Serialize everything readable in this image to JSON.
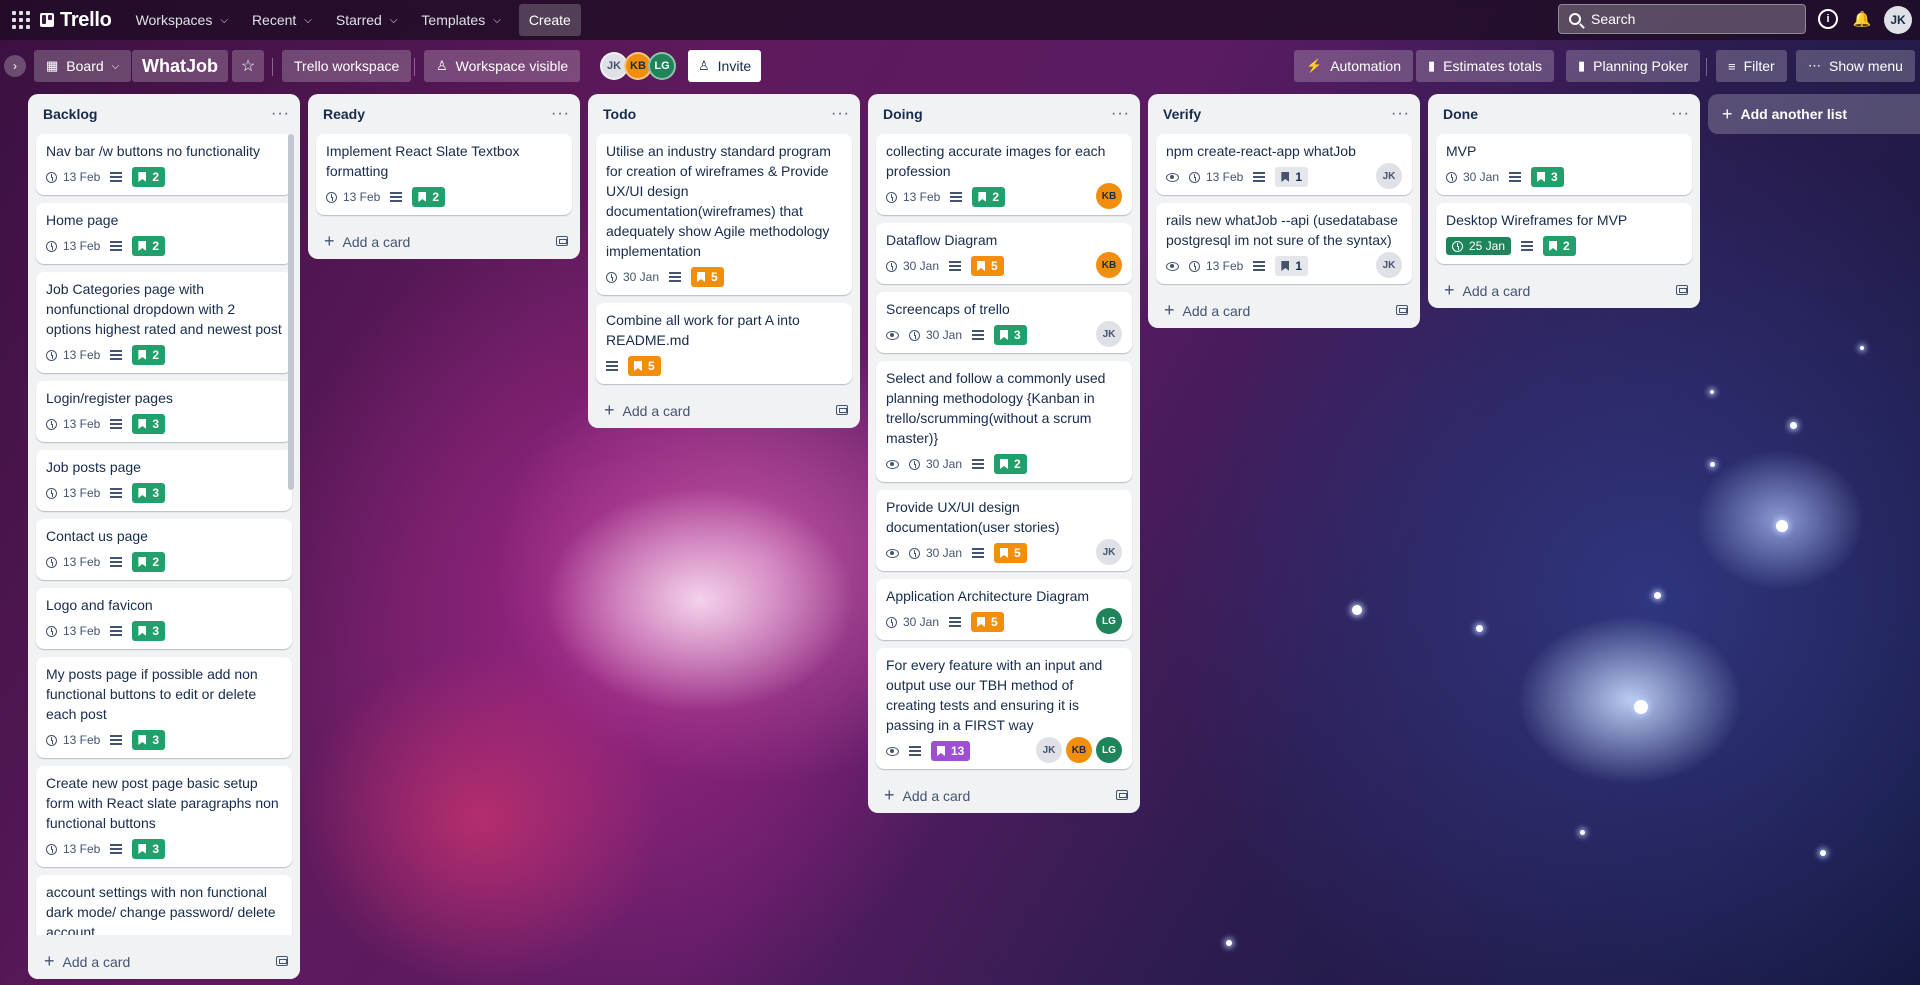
{
  "topnav": {
    "logo_text": "Trello",
    "menu": [
      {
        "label": "Workspaces",
        "has_chevron": true
      },
      {
        "label": "Recent",
        "has_chevron": true
      },
      {
        "label": "Starred",
        "has_chevron": true
      },
      {
        "label": "Templates",
        "has_chevron": true
      }
    ],
    "create_label": "Create",
    "search_placeholder": "Search",
    "user_initials": "JK"
  },
  "board": {
    "view_label": "Board",
    "title": "WhatJob",
    "workspace_label": "Trello workspace",
    "visibility_label": "Workspace visible",
    "invite_label": "Invite",
    "members": [
      "JK",
      "KB",
      "LG"
    ],
    "powerups": [
      "Automation",
      "Estimates totals",
      "Planning Poker"
    ],
    "filter_label": "Filter",
    "show_menu_label": "Show menu"
  },
  "lists": [
    {
      "title": "Backlog",
      "add_card_label": "Add a card",
      "cards": [
        {
          "title": "Nav bar /w buttons no functionality",
          "date": "13 Feb",
          "desc": true,
          "points": "2",
          "color": "green"
        },
        {
          "title": "Home page",
          "date": "13 Feb",
          "desc": true,
          "points": "2",
          "color": "green"
        },
        {
          "title": "Job Categories page with nonfunctional dropdown with 2 options highest rated and newest post",
          "date": "13 Feb",
          "desc": true,
          "points": "2",
          "color": "green"
        },
        {
          "title": "Login/register pages",
          "date": "13 Feb",
          "desc": true,
          "points": "3",
          "color": "green"
        },
        {
          "title": "Job posts page",
          "date": "13 Feb",
          "desc": true,
          "points": "3",
          "color": "green"
        },
        {
          "title": "Contact us page",
          "date": "13 Feb",
          "desc": true,
          "points": "2",
          "color": "green"
        },
        {
          "title": "Logo and favicon",
          "date": "13 Feb",
          "desc": true,
          "points": "3",
          "color": "green"
        },
        {
          "title": "My posts page if possible add non functional buttons to edit or delete each post",
          "date": "13 Feb",
          "desc": true,
          "points": "3",
          "color": "green"
        },
        {
          "title": "Create new post page basic setup form with React slate paragraphs non functional buttons",
          "date": "13 Feb",
          "desc": true,
          "points": "3",
          "color": "green"
        },
        {
          "title": "account settings with non functional dark mode/ change password/ delete account"
        }
      ]
    },
    {
      "title": "Ready",
      "add_card_label": "Add a card",
      "cards": [
        {
          "title": "Implement React Slate Textbox formatting",
          "date": "13 Feb",
          "desc": true,
          "points": "2",
          "color": "green"
        }
      ]
    },
    {
      "title": "Todo",
      "add_card_label": "Add a card",
      "cards": [
        {
          "title": "Utilise an industry standard program for creation of wireframes & Provide UX/UI design documentation(wireframes) that adequately show Agile methodology implementation",
          "date": "30 Jan",
          "desc": true,
          "points": "5",
          "color": "orange"
        },
        {
          "title": "Combine all work for part A into README.md",
          "desc": true,
          "points": "5",
          "color": "orange"
        }
      ]
    },
    {
      "title": "Doing",
      "add_card_label": "Add a card",
      "cards": [
        {
          "title": "collecting accurate images for each profession",
          "date": "13 Feb",
          "desc": true,
          "points": "2",
          "color": "green",
          "members": [
            "KB"
          ]
        },
        {
          "title": "Dataflow Diagram",
          "date": "30 Jan",
          "desc": true,
          "points": "5",
          "color": "orange",
          "members": [
            "KB"
          ]
        },
        {
          "title": "Screencaps of trello",
          "watch": true,
          "date": "30 Jan",
          "desc": true,
          "points": "3",
          "color": "green",
          "members": [
            "JK"
          ]
        },
        {
          "title": "Select and follow a commonly used planning methodology {Kanban in trello/scrumming(without a scrum master)}",
          "watch": true,
          "date": "30 Jan",
          "desc": true,
          "points": "2",
          "color": "green"
        },
        {
          "title": "Provide UX/UI design documentation(user stories)",
          "watch": true,
          "date": "30 Jan",
          "desc": true,
          "points": "5",
          "color": "orange",
          "members": [
            "JK"
          ]
        },
        {
          "title": "Application Architecture Diagram",
          "date": "30 Jan",
          "desc": true,
          "points": "5",
          "color": "orange",
          "members": [
            "LG"
          ]
        },
        {
          "title": "For every feature with an input and output use our TBH method of creating tests and ensuring it is passing in a FIRST way",
          "watch": true,
          "desc": true,
          "points": "13",
          "color": "purple",
          "members": [
            "JK",
            "KB",
            "LG"
          ]
        }
      ]
    },
    {
      "title": "Verify",
      "add_card_label": "Add a card",
      "cards": [
        {
          "title": "npm create-react-app whatJob",
          "watch": true,
          "date": "13 Feb",
          "desc": true,
          "points": "1",
          "color": "gray",
          "members": [
            "JK"
          ]
        },
        {
          "title": "rails new whatJob --api (usedatabase postgresql im not sure of the syntax)",
          "watch": true,
          "date": "13 Feb",
          "desc": true,
          "points": "1",
          "color": "gray",
          "members": [
            "JK"
          ]
        }
      ]
    },
    {
      "title": "Done",
      "add_card_label": "Add a card",
      "cards": [
        {
          "title": "MVP",
          "date": "30 Jan",
          "desc": true,
          "points": "3",
          "color": "green"
        },
        {
          "title": "Desktop Wireframes for MVP",
          "date": "25 Jan",
          "date_done": true,
          "desc": true,
          "points": "2",
          "color": "green"
        }
      ]
    }
  ],
  "add_list_label": "Add another list",
  "colors": {
    "list_bg": "#f1f2f4",
    "green": "#22a06b",
    "orange": "#f18f0c",
    "purple": "#9f4fd4",
    "member_kb": "#f18f0c",
    "member_lg": "#1f845a",
    "member_jk": "#dfe1e6"
  }
}
